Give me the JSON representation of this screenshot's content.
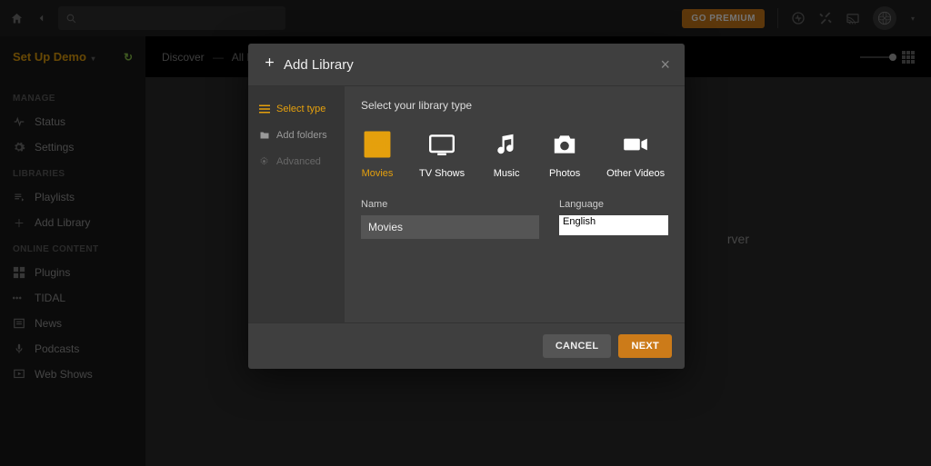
{
  "topbar": {
    "premium_label": "GO PREMIUM"
  },
  "setup": {
    "label": "Set Up Demo"
  },
  "breadcrumb": {
    "a": "Discover",
    "b": "All Libra…"
  },
  "sidebar": {
    "h1": "MANAGE",
    "items1": [
      {
        "label": "Status"
      },
      {
        "label": "Settings"
      }
    ],
    "h2": "LIBRARIES",
    "items2": [
      {
        "label": "Playlists"
      },
      {
        "label": "Add Library"
      }
    ],
    "h3": "ONLINE CONTENT",
    "items3": [
      {
        "label": "Plugins"
      },
      {
        "label": "TIDAL"
      },
      {
        "label": "News"
      },
      {
        "label": "Podcasts"
      },
      {
        "label": "Web Shows"
      }
    ]
  },
  "main": {
    "hint": "rver"
  },
  "modal": {
    "title": "Add Library",
    "steps": {
      "select": "Select type",
      "folders": "Add folders",
      "advanced": "Advanced"
    },
    "pane_title": "Select your library type",
    "types": {
      "movies": "Movies",
      "tv": "TV Shows",
      "music": "Music",
      "photos": "Photos",
      "other": "Other Videos"
    },
    "name_label": "Name",
    "name_value": "Movies",
    "lang_label": "Language",
    "lang_value": "English",
    "cancel": "CANCEL",
    "next": "NEXT"
  }
}
